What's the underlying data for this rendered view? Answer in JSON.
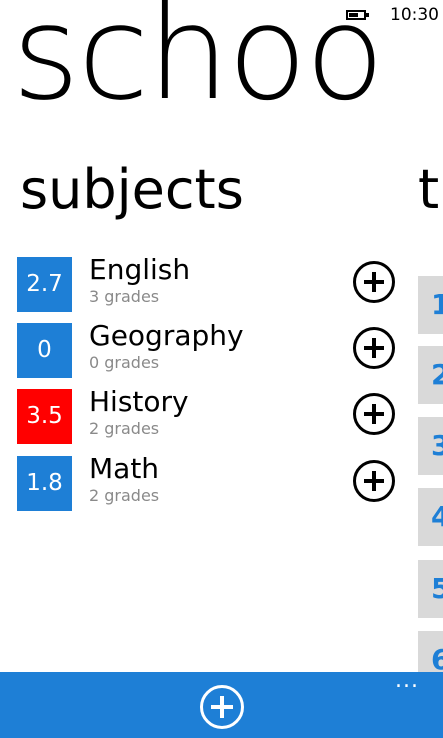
{
  "status_bar": {
    "time": "10:30"
  },
  "panorama": {
    "title": "schoo",
    "current_section": "subjects",
    "next_section_peek": "t"
  },
  "subjects": [
    {
      "average": "2.7",
      "name": "English",
      "grades": "3 grades",
      "tile_color": "#1e7fd6"
    },
    {
      "average": "0",
      "name": "Geography",
      "grades": "0 grades",
      "tile_color": "#1e7fd6"
    },
    {
      "average": "3.5",
      "name": "History",
      "grades": "2 grades",
      "tile_color": "#ff0000"
    },
    {
      "average": "1.8",
      "name": "Math",
      "grades": "2 grades",
      "tile_color": "#1e7fd6"
    }
  ],
  "next_panel_items": [
    "1",
    "2",
    "3",
    "4",
    "5",
    "6"
  ],
  "next_panel_accent": "#1e7fd6",
  "app_bar": {
    "background": "#1e7fd6",
    "add_icon": "plus-circle-icon",
    "more_label": "..."
  }
}
